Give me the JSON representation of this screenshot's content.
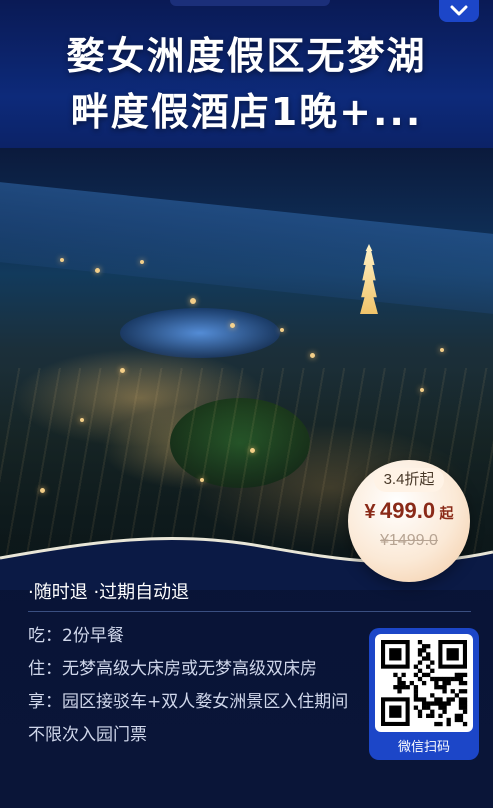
{
  "title": {
    "line1": "婺女洲度假区无梦湖",
    "line2": "畔度假酒店1晚+..."
  },
  "price": {
    "discount": "3.4折起",
    "currency": "¥",
    "amount": "499.0",
    "suffix": "起",
    "original": "¥1499.0"
  },
  "policy": "·随时退 ·过期自动退",
  "details": {
    "eat": "吃：2份早餐",
    "stay": "住：无梦高级大床房或无梦高级双床房",
    "enjoy": "享：园区接驳车+双人婺女洲景区入住期间不限次入园门票"
  },
  "qr": {
    "label": "微信扫码",
    "icon": "qr-code-icon"
  },
  "corner_icon": "chevron-down-icon",
  "colors": {
    "accent_blue": "#1c46c8",
    "price_red": "#8a2a18",
    "badge_cream": "#fbe9d6"
  }
}
